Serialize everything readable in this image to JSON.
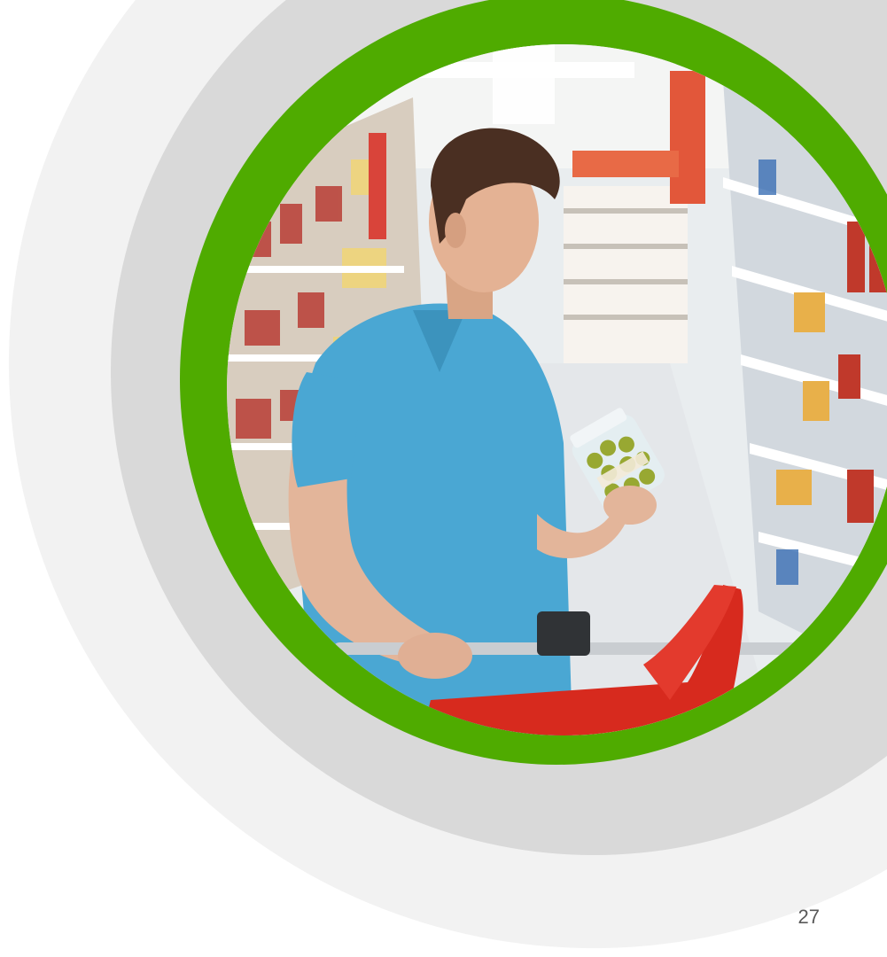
{
  "page": {
    "number": "27"
  },
  "decor": {
    "accent_green": "#4fab00",
    "ring_light": "#f2f2f2",
    "ring_mid": "#d9d9d9"
  }
}
